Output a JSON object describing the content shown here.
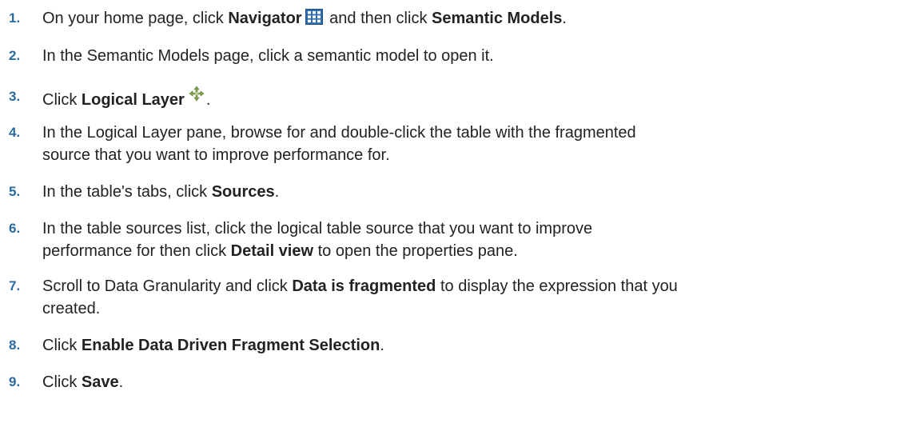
{
  "colors": {
    "step_number": "#2b6aa0",
    "text": "#222222",
    "navigator_icon": "#2f6eb3",
    "logical_icon": "#7fa24a"
  },
  "steps": [
    {
      "number": "1.",
      "parts": [
        "On your home page, click ",
        "Navigator",
        " and then click ",
        "Semantic Models",
        "."
      ],
      "icon": "navigator-grid-icon"
    },
    {
      "number": "2.",
      "text": "In the Semantic Models page, click a semantic model to open it."
    },
    {
      "number": "3.",
      "parts": [
        "Click ",
        "Logical Layer",
        "."
      ],
      "icon": "logical-layer-move-icon"
    },
    {
      "number": "4.",
      "line1": "In the Logical Layer pane, browse for and double-click the table with the fragmented",
      "line2": "source that you want to improve performance for."
    },
    {
      "number": "5.",
      "parts": [
        "In the table's tabs, click ",
        "Sources",
        "."
      ]
    },
    {
      "number": "6.",
      "line1": "In the table sources list, click the logical table source that you want to improve",
      "parts": [
        "performance for then click ",
        "Detail view",
        " to open the properties pane."
      ]
    },
    {
      "number": "7.",
      "parts": [
        "Scroll to Data Granularity and click ",
        "Data is fragmented",
        " to display the expression that you"
      ],
      "line2": "created."
    },
    {
      "number": "8.",
      "parts": [
        "Click ",
        "Enable Data Driven Fragment Selection",
        "."
      ]
    },
    {
      "number": "9.",
      "parts": [
        "Click ",
        "Save",
        "."
      ]
    }
  ]
}
